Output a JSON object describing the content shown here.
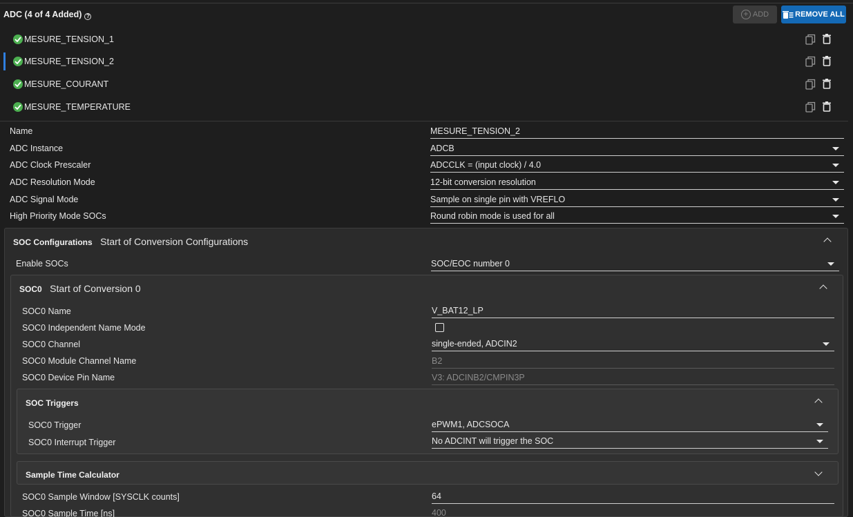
{
  "header": {
    "title": "ADC (4 of 4 Added)",
    "add_label": "ADD",
    "remove_all_label": "REMOVE ALL"
  },
  "instances": [
    {
      "name": "MESURE_TENSION_1",
      "selected": false
    },
    {
      "name": "MESURE_TENSION_2",
      "selected": true
    },
    {
      "name": "MESURE_COURANT",
      "selected": false
    },
    {
      "name": "MESURE_TEMPERATURE",
      "selected": false
    }
  ],
  "properties": [
    {
      "label": "Name",
      "value": "MESURE_TENSION_2",
      "type": "text"
    },
    {
      "label": "ADC Instance",
      "value": "ADCB",
      "type": "select"
    },
    {
      "label": "ADC Clock Prescaler",
      "value": "ADCCLK = (input clock) / 4.0",
      "type": "select"
    },
    {
      "label": "ADC Resolution Mode",
      "value": "12-bit conversion resolution",
      "type": "select"
    },
    {
      "label": "ADC Signal Mode",
      "value": "Sample on single pin with VREFLO",
      "type": "select"
    },
    {
      "label": "High Priority Mode SOCs",
      "value": "Round robin mode is used for all",
      "type": "select"
    }
  ],
  "soc_configurations": {
    "title_bold": "SOC Configurations",
    "title": "Start of Conversion Configurations",
    "enable_label": "Enable SOCs",
    "enable_value": "SOC/EOC number 0"
  },
  "soc0": {
    "title_bold": "SOC0",
    "title": "Start of Conversion 0",
    "name_label": "SOC0 Name",
    "name_value": "V_BAT12_LP",
    "indep_label": "SOC0 Independent Name Mode",
    "indep_checked": false,
    "channel_label": "SOC0 Channel",
    "channel_value": "single-ended, ADCIN2",
    "module_label": "SOC0 Module Channel Name",
    "module_value": "B2",
    "pin_label": "SOC0 Device Pin Name",
    "pin_value": "V3: ADCINB2/CMPIN3P"
  },
  "triggers": {
    "title": "SOC Triggers",
    "trigger_label": "SOC0 Trigger",
    "trigger_value": "ePWM1, ADCSOCA",
    "int_label": "SOC0 Interrupt Trigger",
    "int_value": "No ADCINT will trigger the SOC"
  },
  "sample_calc": {
    "title": "Sample Time Calculator"
  },
  "sample": {
    "window_label": "SOC0 Sample Window [SYSCLK counts]",
    "window_value": "64",
    "time_label": "SOC0 Sample Time [ns]",
    "time_value": "400"
  },
  "colors": {
    "background": "#1e1e1e",
    "accent": "#1469b5",
    "success": "#4caf50",
    "selection": "#2f7fe0"
  }
}
